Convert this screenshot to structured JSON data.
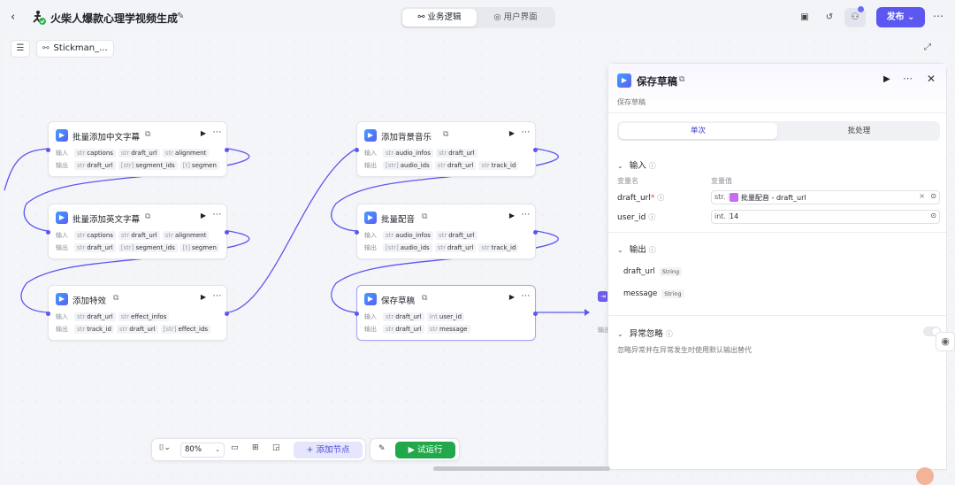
{
  "header": {
    "back_icon": "chevron-left-icon",
    "app_title": "火柴人爆款心理学视频生成",
    "tabs": [
      {
        "label": "业务逻辑",
        "icon": "workflow-icon",
        "active": true
      },
      {
        "label": "用户界面",
        "icon": "palette-icon",
        "active": false
      }
    ],
    "publish_label": "发布",
    "accent_color": "#5b57f0"
  },
  "canvas": {
    "workflow_chip": "Stickman_...",
    "nodes": [
      {
        "title": "批量添加中文字幕",
        "in_label": "输入",
        "out_label": "输出",
        "inputs": [
          {
            "t": "str",
            "n": "captions"
          },
          {
            "t": "str",
            "n": "draft_url"
          },
          {
            "t": "str",
            "n": "alignment"
          }
        ],
        "outputs": [
          {
            "t": "str",
            "n": "draft_url"
          },
          {
            "t": "[str]",
            "n": "segment_ids"
          },
          {
            "t": "[t]",
            "n": "segmen"
          }
        ]
      },
      {
        "title": "批量添加英文字幕",
        "in_label": "输入",
        "out_label": "输出",
        "inputs": [
          {
            "t": "str",
            "n": "captions"
          },
          {
            "t": "str",
            "n": "draft_url"
          },
          {
            "t": "str",
            "n": "alignment"
          }
        ],
        "outputs": [
          {
            "t": "str",
            "n": "draft_url"
          },
          {
            "t": "[str]",
            "n": "segment_ids"
          },
          {
            "t": "[t]",
            "n": "segmen"
          }
        ]
      },
      {
        "title": "添加特效",
        "in_label": "输入",
        "out_label": "输出",
        "inputs": [
          {
            "t": "str",
            "n": "draft_url"
          },
          {
            "t": "str",
            "n": "effect_infos"
          }
        ],
        "outputs": [
          {
            "t": "str",
            "n": "track_id"
          },
          {
            "t": "str",
            "n": "draft_url"
          },
          {
            "t": "[str]",
            "n": "effect_ids"
          }
        ]
      },
      {
        "title": "添加背景音乐",
        "in_label": "输入",
        "out_label": "输出",
        "inputs": [
          {
            "t": "str",
            "n": "audio_infos"
          },
          {
            "t": "str",
            "n": "draft_url"
          }
        ],
        "outputs": [
          {
            "t": "[str]",
            "n": "audio_ids"
          },
          {
            "t": "str",
            "n": "draft_url"
          },
          {
            "t": "str",
            "n": "track_id"
          }
        ]
      },
      {
        "title": "批量配音",
        "in_label": "输入",
        "out_label": "输出",
        "inputs": [
          {
            "t": "str",
            "n": "audio_infos"
          },
          {
            "t": "str",
            "n": "draft_url"
          }
        ],
        "outputs": [
          {
            "t": "[str]",
            "n": "audio_ids"
          },
          {
            "t": "str",
            "n": "draft_url"
          },
          {
            "t": "str",
            "n": "track_id"
          }
        ]
      },
      {
        "title": "保存草稿",
        "in_label": "输入",
        "out_label": "输出",
        "selected": true,
        "inputs": [
          {
            "t": "str",
            "n": "draft_url"
          },
          {
            "t": "int",
            "n": "user_id"
          }
        ],
        "outputs": [
          {
            "t": "str",
            "n": "draft_url"
          },
          {
            "t": "str",
            "n": "message"
          }
        ]
      }
    ],
    "dest_node_label": "输出"
  },
  "panel": {
    "title": "保存草稿",
    "description": "保存草稿",
    "tabs": [
      "单次",
      "批处理"
    ],
    "active_tab": "单次",
    "input_section": "输入",
    "col_name": "变量名",
    "col_value": "变量值",
    "fields": [
      {
        "name": "draft_url",
        "required": true,
        "type": "str.",
        "value": "批量配音 - draft_url"
      },
      {
        "name": "user_id",
        "required": false,
        "type": "int.",
        "value": "14"
      }
    ],
    "output_section": "输出",
    "outputs": [
      {
        "name": "draft_url",
        "type": "String"
      },
      {
        "name": "message",
        "type": "String"
      }
    ],
    "error_section": "异常忽略",
    "error_desc": "忽略异常并在异常发生时使用默认输出替代",
    "error_toggle": false
  },
  "toolbar": {
    "zoom": "80%",
    "add_node": "添加节点",
    "run": "试运行"
  }
}
